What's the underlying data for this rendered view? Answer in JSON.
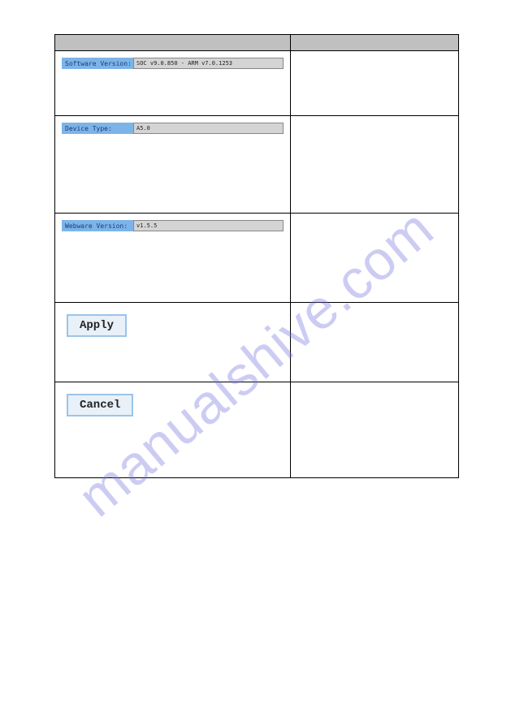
{
  "watermark": "manualshive.com",
  "rows": {
    "software_version": {
      "label": "Software Version:",
      "value": "SOC v9.0.850 - ARM v7.0.1253"
    },
    "device_type": {
      "label": "Device Type:",
      "value": "A5.0"
    },
    "webware_version": {
      "label": "Webware Version:",
      "value": "v1.5.5"
    }
  },
  "buttons": {
    "apply": "Apply",
    "cancel": "Cancel"
  }
}
